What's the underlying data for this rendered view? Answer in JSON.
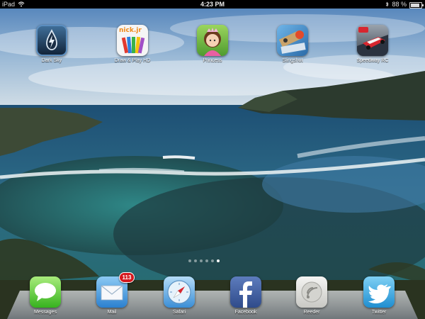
{
  "status_bar": {
    "device": "iPad",
    "time": "4:23 PM",
    "battery": "88 %",
    "battery_level": 0.88
  },
  "home_apps": [
    {
      "label": "Dark Sky",
      "icon": "dark-sky-icon"
    },
    {
      "label": "Draw & Play HD",
      "icon": "nick-jr-draw-icon",
      "brand_text": "nick.jr"
    },
    {
      "label": "Princess",
      "icon": "princess-icon"
    },
    {
      "label": "Slingshot",
      "icon": "slingshot-icon"
    },
    {
      "label": "Speedway RC",
      "icon": "speedway-rc-icon"
    }
  ],
  "page_indicator": {
    "count": 6,
    "active_index": 5
  },
  "dock_apps": [
    {
      "label": "Messages",
      "icon": "messages-icon"
    },
    {
      "label": "Mail",
      "icon": "mail-icon",
      "badge": "113"
    },
    {
      "label": "Safari",
      "icon": "safari-icon"
    },
    {
      "label": "Facebook",
      "icon": "facebook-icon"
    },
    {
      "label": "Reeder",
      "icon": "reeder-icon"
    },
    {
      "label": "Twitter",
      "icon": "twitter-icon"
    }
  ],
  "colors": {
    "badge": "#d4191f",
    "facebook": "#3b5998",
    "twitter": "#2aa9e0"
  }
}
